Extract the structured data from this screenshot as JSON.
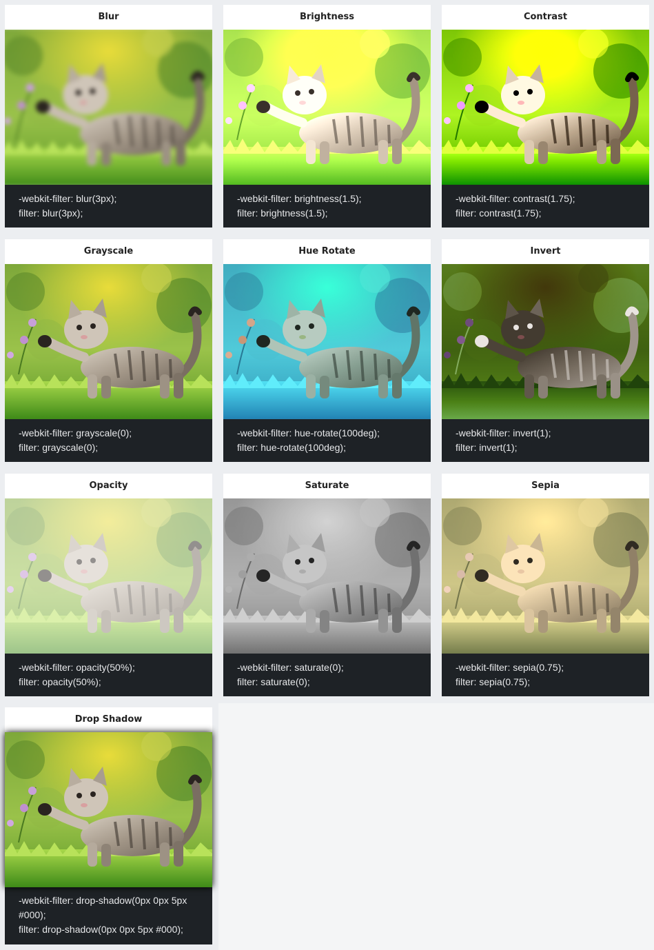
{
  "cards": [
    {
      "title": "Blur",
      "code": [
        "-webkit-filter: blur(3px);",
        "filter: blur(3px);"
      ]
    },
    {
      "title": "Brightness",
      "code": [
        "-webkit-filter: brightness(1.5);",
        "filter: brightness(1.5);"
      ]
    },
    {
      "title": "Contrast",
      "code": [
        "-webkit-filter: contrast(1.75);",
        "filter: contrast(1.75);"
      ]
    },
    {
      "title": "Grayscale",
      "code": [
        "-webkit-filter: grayscale(0);",
        "filter: grayscale(0);"
      ]
    },
    {
      "title": "Hue Rotate",
      "code": [
        "-webkit-filter: hue-rotate(100deg);",
        "filter: hue-rotate(100deg);"
      ]
    },
    {
      "title": "Invert",
      "code": [
        "-webkit-filter: invert(1);",
        "filter: invert(1);"
      ]
    },
    {
      "title": "Opacity",
      "code": [
        "-webkit-filter: opacity(50%);",
        "filter: opacity(50%);"
      ]
    },
    {
      "title": "Saturate",
      "code": [
        "-webkit-filter: saturate(0);",
        "filter: saturate(0);"
      ]
    },
    {
      "title": "Sepia",
      "code": [
        "-webkit-filter: sepia(0.75);",
        "filter: sepia(0.75);"
      ]
    },
    {
      "title": "Drop Shadow",
      "code": [
        "-webkit-filter: drop-shadow(0px 0px 5px #000);",
        "filter: drop-shadow(0px 0px 5px #000);"
      ]
    }
  ],
  "colors": {
    "page_bg": "#f4f5f6",
    "cell_bg": "#eceef1",
    "card_bg": "#ffffff",
    "code_bg": "#1e2226",
    "code_text": "#e7e8ea"
  }
}
